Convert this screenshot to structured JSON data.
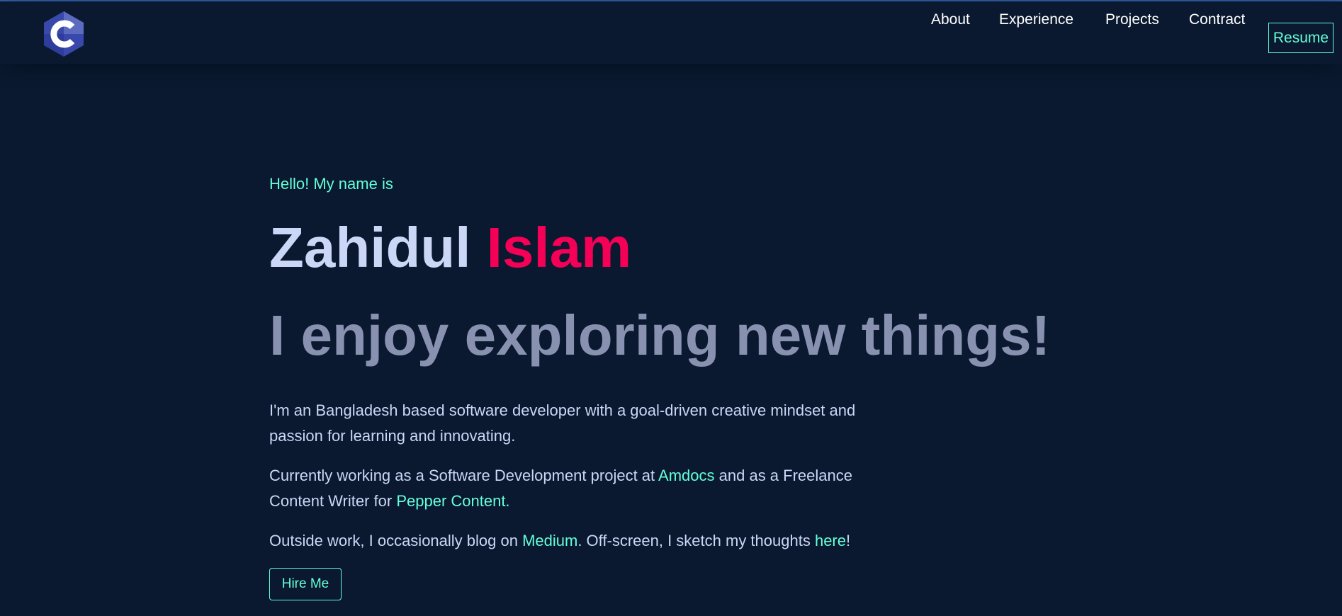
{
  "colors": {
    "background": "#0a192f",
    "accent": "#64ffda",
    "name_highlight": "#f50057",
    "heading": "#ccd6f6",
    "muted": "#8892b0"
  },
  "header": {
    "logo_icon": "hexagon-c-logo-icon",
    "nav": [
      {
        "label": "About"
      },
      {
        "label": "Experience"
      },
      {
        "label": "Projects"
      },
      {
        "label": "Contract"
      }
    ],
    "resume_label": "Resume"
  },
  "hero": {
    "greeting": "Hello! My name is",
    "name_first": "Zahidul",
    "name_last": "Islam",
    "tagline": "I enjoy exploring new things!",
    "intro": "I'm an Bangladesh based software developer with a goal-driven creative mindset and passion for learning and innovating.",
    "work_prefix": "Currently working as a Software Development project at ",
    "work_company": "Amdocs",
    "work_middle": " and as a Freelance Content Writer for ",
    "work_client": "Pepper Content.",
    "outside_prefix": "Outside work, I occasionally blog on ",
    "outside_blog": "Medium",
    "outside_middle": ". Off-screen, I sketch my thoughts ",
    "outside_link": "here",
    "outside_suffix": "!",
    "hire_label": "Hire Me"
  }
}
